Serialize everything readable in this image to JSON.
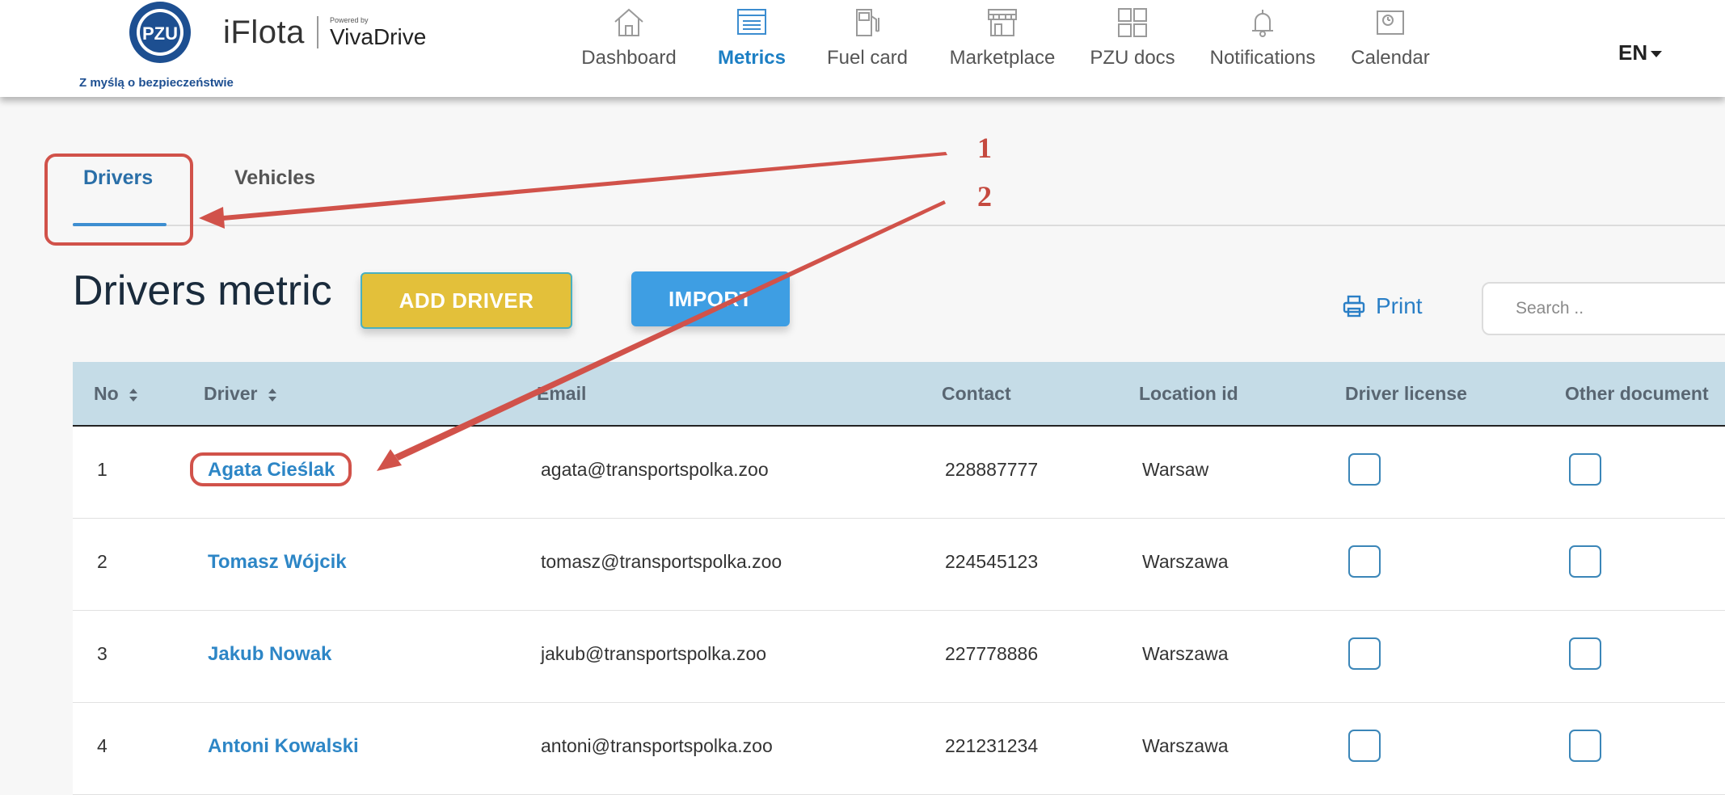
{
  "header": {
    "logo_text": "PZU",
    "tagline": "Z myślą o bezpieczeństwie",
    "brand": "iFlota",
    "powered_by": "Powered by",
    "partner": "VivaDrive",
    "language": "EN"
  },
  "nav": [
    {
      "label": "Dashboard",
      "icon": "home-icon",
      "active": false
    },
    {
      "label": "Metrics",
      "icon": "list-icon",
      "active": true
    },
    {
      "label": "Fuel card",
      "icon": "fuel-pump-icon",
      "active": false
    },
    {
      "label": "Marketplace",
      "icon": "store-icon",
      "active": false
    },
    {
      "label": "PZU docs",
      "icon": "grid-icon",
      "active": false
    },
    {
      "label": "Notifications",
      "icon": "bell-icon",
      "active": false
    },
    {
      "label": "Calendar",
      "icon": "calendar-icon",
      "active": false
    }
  ],
  "tabs": [
    {
      "label": "Drivers",
      "active": true
    },
    {
      "label": "Vehicles",
      "active": false
    }
  ],
  "page": {
    "title": "Drivers metric",
    "add_button": "ADD DRIVER",
    "import_button": "IMPORT",
    "print": "Print",
    "search_placeholder": "Search .."
  },
  "table": {
    "columns": [
      "No",
      "Driver",
      "Email",
      "Contact",
      "Location id",
      "Driver license",
      "Other document"
    ],
    "rows": [
      {
        "no": "1",
        "driver": "Agata Cieślak",
        "email": "agata@transportspolka.zoo",
        "contact": "228887777",
        "location": "Warsaw"
      },
      {
        "no": "2",
        "driver": "Tomasz Wójcik",
        "email": "tomasz@transportspolka.zoo",
        "contact": "224545123",
        "location": "Warszawa"
      },
      {
        "no": "3",
        "driver": "Jakub Nowak",
        "email": "jakub@transportspolka.zoo",
        "contact": "227778886",
        "location": "Warszawa"
      },
      {
        "no": "4",
        "driver": "Antoni Kowalski",
        "email": "antoni@transportspolka.zoo",
        "contact": "221231234",
        "location": "Warszawa"
      }
    ]
  },
  "annotations": [
    "1",
    "2"
  ],
  "colors": {
    "accent": "#1c7fc4",
    "add_button": "#e3c03a",
    "import_button": "#3e9ee3",
    "table_header": "#c5dce7",
    "annotation": "#d1524a"
  }
}
